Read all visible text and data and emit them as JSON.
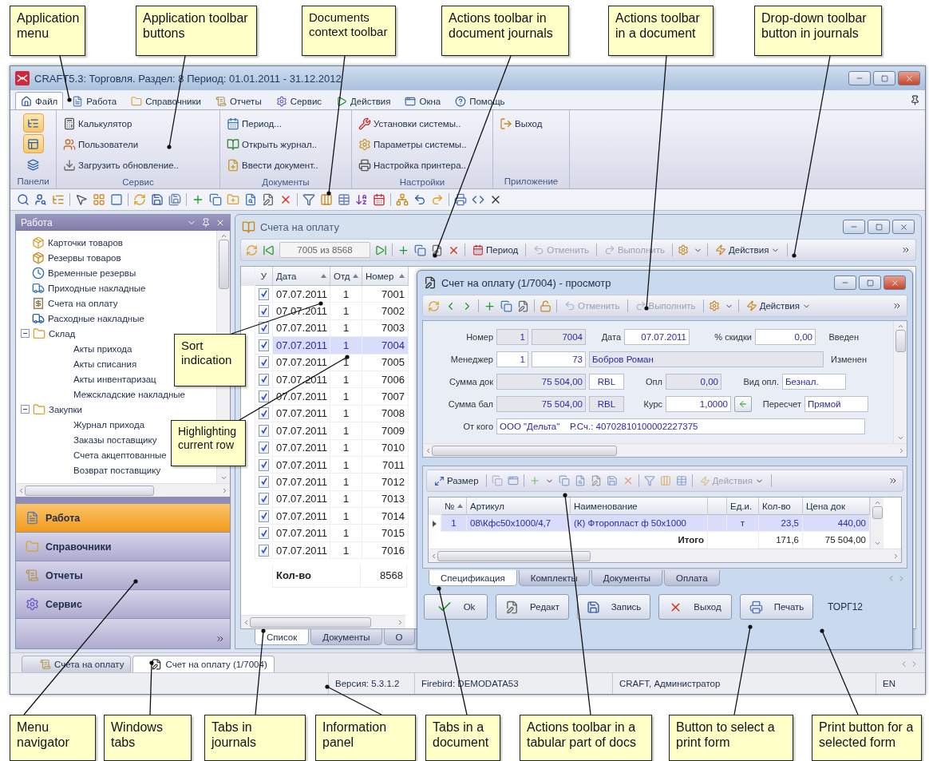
{
  "callouts": [
    "Application menu",
    "Application toolbar buttons",
    "Documents context toolbar",
    "Actions toolbar in document journals",
    "Actions toolbar in a document",
    "Drop-down toolbar button in journals",
    "Sort indication",
    "Highlighting current row",
    "Menu navigator",
    "Windows tabs",
    "Tabs in journals",
    "Information panel",
    "Tabs in a document",
    "Actions toolbar in a tabular part of docs",
    "Button to select a print form",
    "Print button for a selected form"
  ],
  "window": {
    "title": "CRAFT5.3: Торговля. Раздел: 8 Период: 01.01.2011 - 31.12.2012"
  },
  "menu": [
    {
      "label": "Файл",
      "selected": true
    },
    {
      "label": "Работа",
      "selected": false
    },
    {
      "label": "Справочники",
      "selected": false
    },
    {
      "label": "Отчеты",
      "selected": false
    },
    {
      "label": "Сервис",
      "selected": false
    },
    {
      "label": "Действия",
      "selected": false
    },
    {
      "label": "Окна",
      "selected": false
    },
    {
      "label": "Помощь",
      "selected": false
    }
  ],
  "ribbon": [
    {
      "title": "Панели",
      "kind": "icons",
      "items": [
        {
          "active": true
        },
        {
          "active": true
        },
        {
          "active": false
        }
      ]
    },
    {
      "title": "Сервис",
      "kind": "list",
      "items": [
        {
          "label": "Калькулятор"
        },
        {
          "label": "Пользователи"
        },
        {
          "label": "Загрузить обновление.."
        }
      ]
    },
    {
      "title": "Документы",
      "kind": "list",
      "items": [
        {
          "label": "Период..."
        },
        {
          "label": "Открыть журнал.."
        },
        {
          "label": "Ввести документ.."
        }
      ]
    },
    {
      "title": "Настройки",
      "kind": "list",
      "items": [
        {
          "label": "Установки системы.."
        },
        {
          "label": "Параметры системы.."
        },
        {
          "label": "Настройка принтера.."
        }
      ]
    },
    {
      "title": "Приложение",
      "kind": "list",
      "items": [
        {
          "label": "Выход"
        }
      ]
    }
  ],
  "navigator": {
    "title": "Работа",
    "tree": [
      {
        "label": "Карточки товаров"
      },
      {
        "label": "Резервы товаров"
      },
      {
        "label": "Временные резервы"
      },
      {
        "label": "Приходные накладные"
      },
      {
        "label": "Счета на оплату"
      },
      {
        "label": "Расходные накладные"
      },
      {
        "label": "Склад",
        "expanded": true,
        "children": [
          {
            "label": "Акты прихода"
          },
          {
            "label": "Акты списания"
          },
          {
            "label": "Акты инвентаризац"
          },
          {
            "label": "Межскладские накладные"
          }
        ]
      },
      {
        "label": "Закупки",
        "expanded": true,
        "children": [
          {
            "label": "Журнал прихода"
          },
          {
            "label": "Заказы поставщику"
          },
          {
            "label": "Счета акцептованные"
          },
          {
            "label": "Возврат поставщику"
          }
        ]
      }
    ],
    "buttons": [
      {
        "label": "Работа",
        "selected": true
      },
      {
        "label": "Справочники",
        "selected": false
      },
      {
        "label": "Отчеты",
        "selected": false
      },
      {
        "label": "Сервис",
        "selected": false
      }
    ]
  },
  "journal": {
    "title": "Счета на оплату",
    "toolbar": {
      "position": "7005 из 8568",
      "buttons": [
        {
          "label": "Период",
          "disabled": false
        },
        {
          "label": "Отменить",
          "disabled": true
        },
        {
          "label": "Выполнить",
          "disabled": true
        },
        {
          "label": "Действия",
          "disabled": false
        }
      ]
    },
    "grid": {
      "columns": [
        {
          "label": "У",
          "sorted": false
        },
        {
          "label": "Дата",
          "sorted": true
        },
        {
          "label": "Отд",
          "sorted": true
        },
        {
          "label": "Номер",
          "sorted": true
        }
      ],
      "rows": [
        {
          "checked": true,
          "date": "07.07.2011",
          "dept": "1",
          "number": "7001",
          "selected": false
        },
        {
          "checked": true,
          "date": "07.07.2011",
          "dept": "1",
          "number": "7002",
          "selected": false
        },
        {
          "checked": true,
          "date": "07.07.2011",
          "dept": "1",
          "number": "7003",
          "selected": false
        },
        {
          "checked": true,
          "date": "07.07.2011",
          "dept": "1",
          "number": "7004",
          "selected": true
        },
        {
          "checked": true,
          "date": "07.07.2011",
          "dept": "1",
          "number": "7005",
          "selected": false
        },
        {
          "checked": true,
          "date": "07.07.2011",
          "dept": "1",
          "number": "7006",
          "selected": false
        },
        {
          "checked": true,
          "date": "07.07.2011",
          "dept": "1",
          "number": "7007",
          "selected": false
        },
        {
          "checked": true,
          "date": "07.07.2011",
          "dept": "1",
          "number": "7008",
          "selected": false
        },
        {
          "checked": true,
          "date": "07.07.2011",
          "dept": "1",
          "number": "7009",
          "selected": false
        },
        {
          "checked": true,
          "date": "07.07.2011",
          "dept": "1",
          "number": "7010",
          "selected": false
        },
        {
          "checked": true,
          "date": "07.07.2011",
          "dept": "1",
          "number": "7011",
          "selected": false
        },
        {
          "checked": true,
          "date": "07.07.2011",
          "dept": "1",
          "number": "7012",
          "selected": false
        },
        {
          "checked": true,
          "date": "07.07.2011",
          "dept": "1",
          "number": "7013",
          "selected": false
        },
        {
          "checked": true,
          "date": "07.07.2011",
          "dept": "1",
          "number": "7014",
          "selected": false
        },
        {
          "checked": true,
          "date": "07.07.2011",
          "dept": "1",
          "number": "7015",
          "selected": false
        },
        {
          "checked": true,
          "date": "07.07.2011",
          "dept": "1",
          "number": "7016",
          "selected": false
        }
      ],
      "footer_label": "Кол-во",
      "footer_count": "8568"
    },
    "tabs": [
      {
        "label": "Список",
        "selected": true
      },
      {
        "label": "Документы",
        "selected": false
      },
      {
        "label": "О",
        "selected": false
      }
    ]
  },
  "document": {
    "title": "Счет на оплату (1/7004) - просмотр",
    "toolbar": [
      {
        "label": "Отменить",
        "disabled": true
      },
      {
        "label": "Выполнить",
        "disabled": true
      },
      {
        "label": "Действия",
        "disabled": false
      }
    ],
    "form": [
      {
        "items": [
          {
            "kind": "label",
            "text": "Номер"
          },
          {
            "kind": "field",
            "value": "1",
            "readonly": true
          },
          {
            "kind": "field",
            "value": "7004",
            "readonly": true
          },
          {
            "kind": "label",
            "text": "Дата"
          },
          {
            "kind": "field",
            "value": "07.07.2011",
            "readonly": false
          },
          {
            "kind": "label",
            "text": "% скидки"
          },
          {
            "kind": "field",
            "value": "0,00",
            "readonly": false
          },
          {
            "kind": "label",
            "text": "Введен"
          }
        ]
      },
      {
        "items": [
          {
            "kind": "label",
            "text": "Менеджер"
          },
          {
            "kind": "field",
            "value": "1",
            "readonly": false
          },
          {
            "kind": "field",
            "value": "73",
            "readonly": false
          },
          {
            "kind": "field",
            "value": "Бобров Роман",
            "readonly": true
          },
          {
            "kind": "label",
            "text": "Изменен"
          }
        ]
      },
      {
        "items": [
          {
            "kind": "label",
            "text": "Сумма док"
          },
          {
            "kind": "field",
            "value": "75 504,00",
            "readonly": true
          },
          {
            "kind": "field",
            "value": "RBL",
            "readonly": false
          },
          {
            "kind": "label",
            "text": "Опл"
          },
          {
            "kind": "field",
            "value": "0,00",
            "readonly": true
          },
          {
            "kind": "label",
            "text": "Вид опл."
          },
          {
            "kind": "field",
            "value": "Безнал.",
            "readonly": false
          }
        ]
      },
      {
        "items": [
          {
            "kind": "label",
            "text": "Сумма бал"
          },
          {
            "kind": "field",
            "value": "75 504,00",
            "readonly": true
          },
          {
            "kind": "field",
            "value": "RBL",
            "readonly": true
          },
          {
            "kind": "label",
            "text": "Курс"
          },
          {
            "kind": "field",
            "value": "1,0000",
            "readonly": false
          },
          {
            "kind": "button"
          },
          {
            "kind": "label",
            "text": "Пересчет"
          },
          {
            "kind": "field",
            "value": "Прямой",
            "readonly": false
          }
        ]
      },
      {
        "items": [
          {
            "kind": "label",
            "text": "От кого"
          },
          {
            "kind": "field",
            "value": "ООО \"Дельта\"    Р.Сч.: 40702810100002227375",
            "readonly": false
          }
        ]
      }
    ],
    "table": {
      "toolbar": [
        {
          "label": "Размер",
          "disabled": false
        },
        {
          "label": "Действия",
          "disabled": true
        }
      ],
      "columns": [
        {
          "label": "№",
          "sorted": true
        },
        {
          "label": "Артикул",
          "sorted": false
        },
        {
          "label": "Наименование",
          "sorted": false
        },
        {
          "label": "Ед.и.",
          "sorted": false
        },
        {
          "label": "Кол-во",
          "sorted": false
        },
        {
          "label": "Цена док",
          "sorted": false
        }
      ],
      "rows": [
        {
          "cells": [
            "1",
            "08\\Кфс50х1000/4,7",
            "(К) Фторопласт ф 50х1000",
            "т",
            "23,5",
            "440,00"
          ],
          "selected": true
        }
      ],
      "total": {
        "label": "Итого",
        "quantity": "171,6",
        "amount": "75 504,00"
      }
    },
    "tabs": [
      {
        "label": "Спецификация",
        "selected": true
      },
      {
        "label": "Комплекты",
        "selected": false
      },
      {
        "label": "Документы",
        "selected": false
      },
      {
        "label": "Оплата",
        "selected": false
      }
    ],
    "buttons": [
      {
        "label": "Ok"
      },
      {
        "label": "Редакт"
      },
      {
        "label": "Запись"
      },
      {
        "label": "Выход"
      },
      {
        "label": "Печать"
      }
    ],
    "print_form": "ТОРГ12"
  },
  "window_tabs": [
    {
      "label": "Счета на оплату",
      "selected": false
    },
    {
      "label": "Счет на оплату (1/7004)",
      "selected": true
    }
  ],
  "status_bar": [
    "Версия: 5.3.1.2",
    "Firebird: DEMODATA53",
    "CRAFT, Администратор",
    "EN"
  ]
}
